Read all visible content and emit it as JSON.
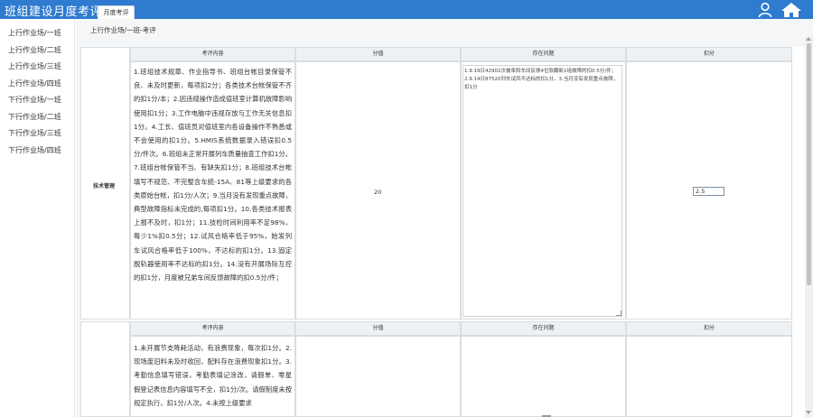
{
  "header": {
    "app_title": "班组建设月度考评",
    "tab_label": "月度考评",
    "user_icon": "user-icon",
    "home_icon": "home-icon"
  },
  "sidebar": {
    "items": [
      {
        "label": "上行作业场/一班"
      },
      {
        "label": "上行作业场/二班"
      },
      {
        "label": "上行作业场/三班"
      },
      {
        "label": "上行作业场/四班"
      },
      {
        "label": "下行作业场/一班"
      },
      {
        "label": "下行作业场/二班"
      },
      {
        "label": "下行作业场/三班"
      },
      {
        "label": "下行作业场/四班"
      }
    ]
  },
  "main": {
    "breadcrumb": "上行作业场/一班-考评",
    "columns": [
      "考评内容",
      "分值",
      "存在问题",
      "扣分"
    ],
    "rows": [
      {
        "category": "技术管理",
        "content": "1.班组技术规章、作业指导书、班组台帐目录保管不良、未及时更新，每项扣2分；各类技术台帐保管不齐的扣1分/本；2.因违规操作造成值班室计算机故障影响使用扣1分；3.工作电脑中违规存放与工作无关信息扣1分。4.工长、值班员对值班室内各设备操作不熟悉或不会使用的扣1分。5.HMIS系统数据录入错误扣0.5分/件次。6.班组未正常开展列车质量抽查工作扣1分。7.班组台帐保管不当、有缺失扣1分；8.班组技术台帐填写不规范、不完整含车统-15A、81等上级要求的各类原始台帐，扣1分/人次；9.当月没有发现重点故障，典型故障指标未完成的,每项扣1分。10.各类技术报表上报不及时，扣1分；11.技检时间利用率不足98%，每少1%扣0.5分；12.试风合格率低于95%，始发列车试风合格率低于100%，不达标的扣1分。13.固定脱轨器使用率不达标的扣1分。14.没有开展场际互控的扣1分，月度被兄弟车间反馈故障的扣0.5分/件；",
        "score": "20",
        "issues": "1.9.19日42902次被阜阳车间反馈4位软翻新1组故障的扣0.5分/件；2.9.14日87520列车试风不达标的扣1分。3.当月没有发现重点故障，扣1分",
        "deduction": "2.5"
      },
      {
        "category": "",
        "content": "1.未开展节支降耗活动，有浪费现象，每次扣1分。2.现场废旧料未及时收回，配料存在浪费现象扣1分。3.考勤信息填写错误，考勤表填记涂改，请假单、零星假登记表信息内容填写不全，扣1分/次。请假制度未按规定执行，扣1分/人次。4.未按上级要求",
        "score": "",
        "issues": "",
        "deduction": ""
      }
    ]
  }
}
